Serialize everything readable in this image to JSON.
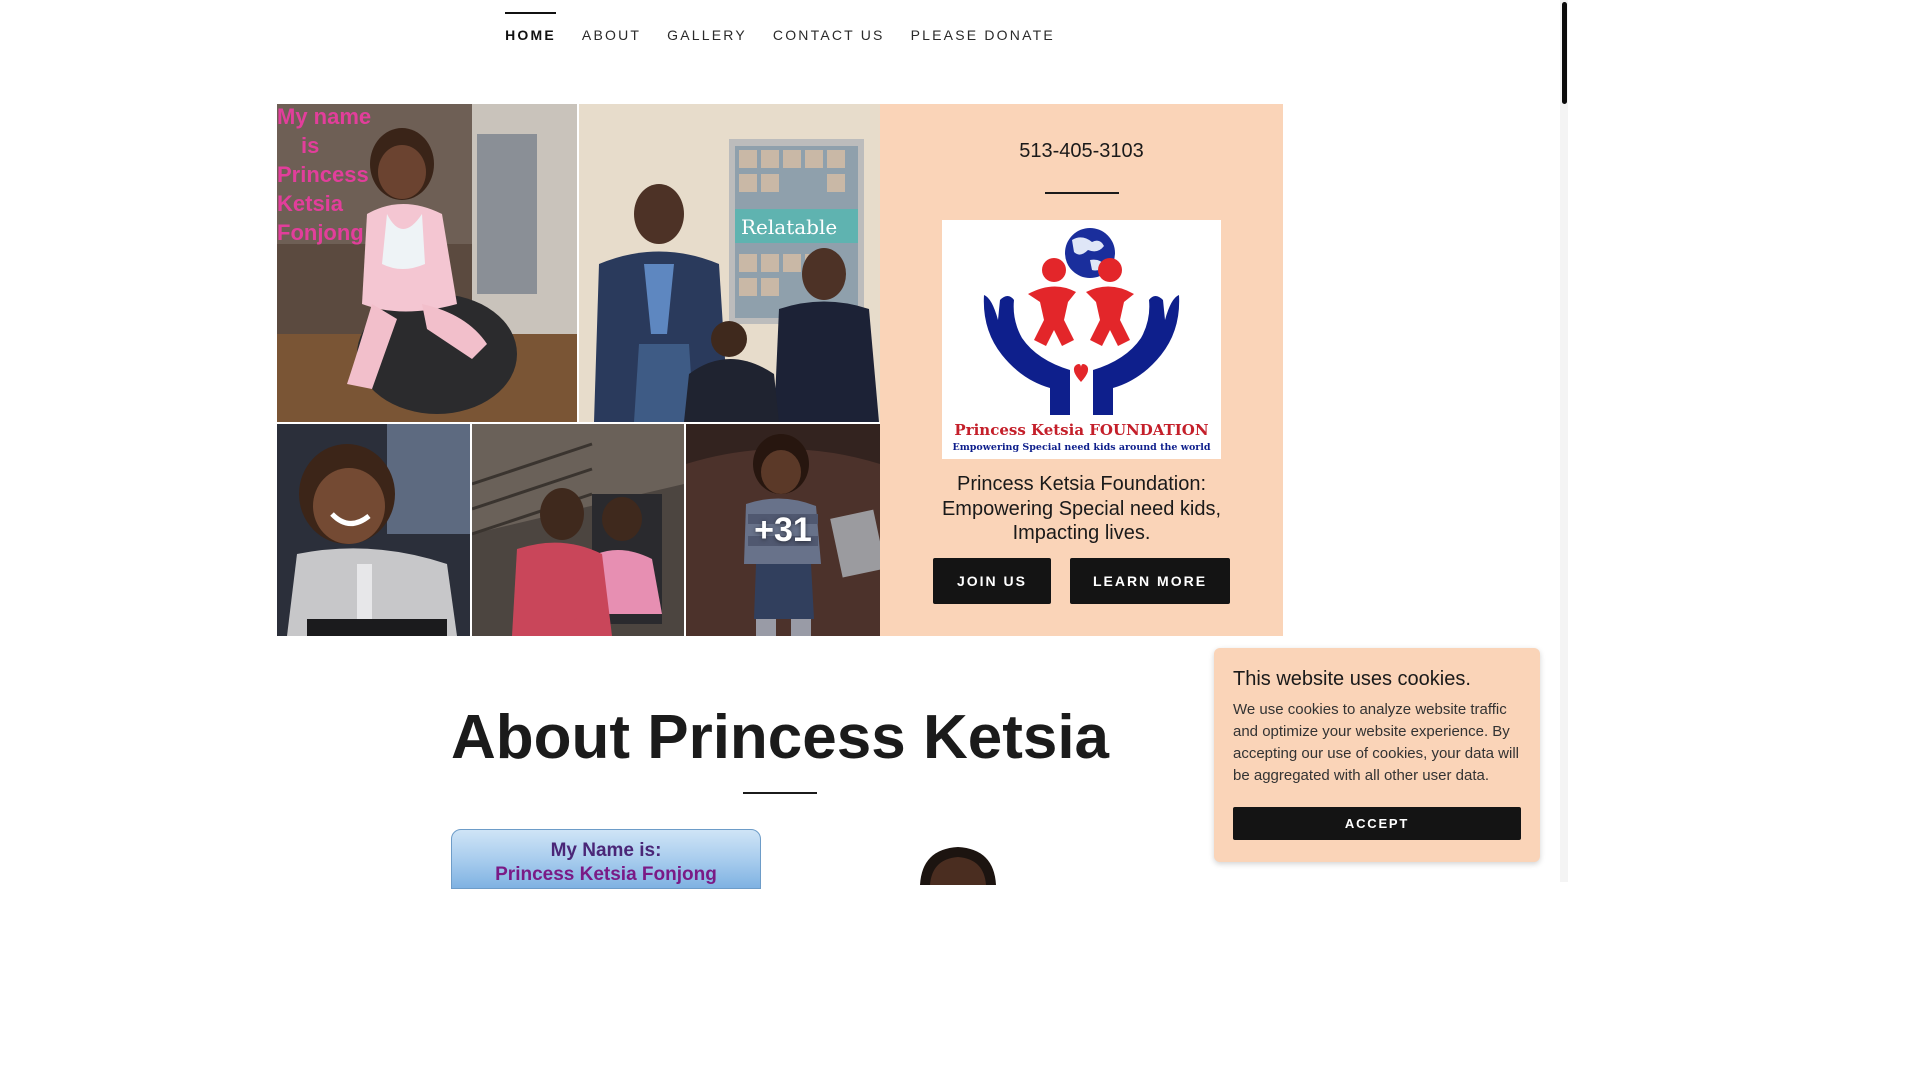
{
  "nav": {
    "items": [
      {
        "label": "HOME",
        "active": true
      },
      {
        "label": "ABOUT",
        "active": false
      },
      {
        "label": "GALLERY",
        "active": false
      },
      {
        "label": "CONTACT US",
        "active": false
      },
      {
        "label": "PLEASE DONATE",
        "active": false
      }
    ]
  },
  "hero": {
    "gallery": {
      "photo1_overlay_text": [
        "My name",
        "is",
        "Princess",
        "Ketsia",
        "Fonjong"
      ],
      "photo2_poster_text": "Relatable",
      "more_count": "+31"
    },
    "phone": "513-405-3103",
    "logo": {
      "name": "Princess Ketsia FOUNDATION",
      "slogan": "Empowering Special need kids around the world"
    },
    "tagline": "Princess Ketsia Foundation: Empowering Special need kids, Impacting lives.",
    "buttons": {
      "join": "JOIN US",
      "learn": "LEARN MORE"
    }
  },
  "about": {
    "title": "About Princess Ketsia",
    "card_line1": "My Name is:",
    "card_line2": "Princess Ketsia Fonjong"
  },
  "cookie": {
    "title": "This website uses cookies.",
    "text": "We use cookies to analyze website traffic and optimize your website experience. By accepting our use of cookies, your data will be aggregated with all other user data.",
    "accept": "ACCEPT"
  },
  "colors": {
    "panel": "#fad4b8",
    "button": "#141414",
    "logo_blue": "#0e1f8c",
    "logo_red": "#e3262a"
  }
}
